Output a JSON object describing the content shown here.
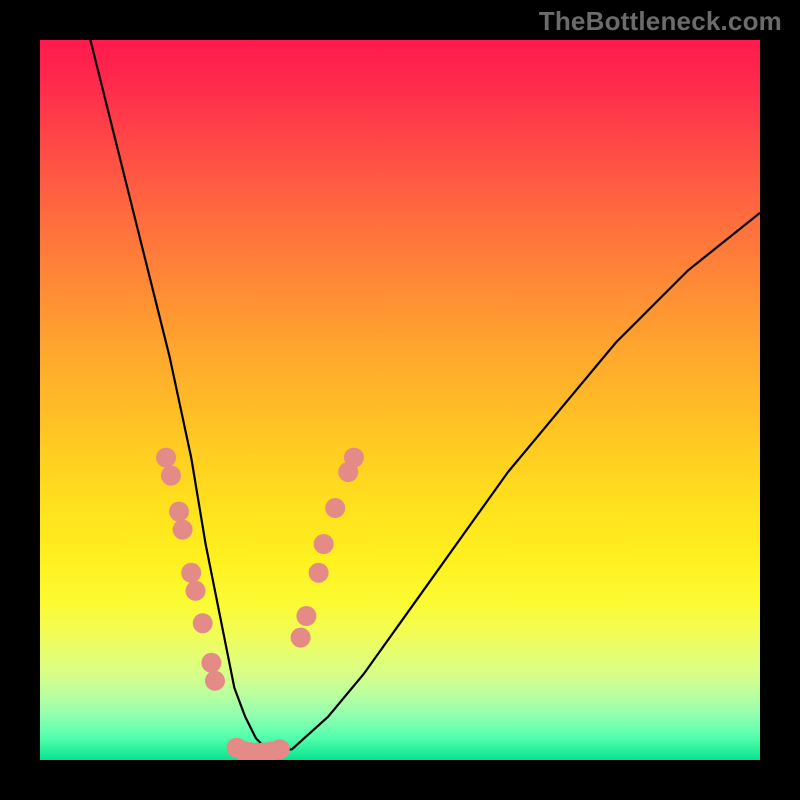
{
  "watermark": "TheBottleneck.com",
  "colors": {
    "frame": "#000000",
    "curve_stroke": "#000000",
    "bead_fill": "#e48b87",
    "gradient_top": "#ff1a4d",
    "gradient_bottom": "#09e28e"
  },
  "chart_data": {
    "type": "line",
    "title": "",
    "xlabel": "",
    "ylabel": "",
    "xlim": [
      0,
      100
    ],
    "ylim": [
      0,
      100
    ],
    "grid": false,
    "legend": false,
    "series": [
      {
        "name": "v-curve",
        "x": [
          7,
          10,
          12,
          14,
          16,
          18,
          19.5,
          21,
          22,
          23,
          24,
          25,
          26,
          27,
          28.5,
          30,
          32,
          35,
          40,
          45,
          50,
          55,
          60,
          65,
          70,
          75,
          80,
          85,
          90,
          95,
          100
        ],
        "y": [
          100,
          88,
          80,
          72,
          64,
          56,
          49,
          42,
          36,
          30,
          25,
          20,
          15,
          10,
          6,
          3,
          1,
          1.5,
          6,
          12,
          19,
          26,
          33,
          40,
          46,
          52,
          58,
          63,
          68,
          72,
          76
        ]
      }
    ],
    "annotations": {
      "beads_left": {
        "x": [
          17.5,
          18.2,
          19.3,
          19.8,
          21.0,
          21.6,
          22.6,
          23.8,
          24.3
        ],
        "y": [
          42,
          39.5,
          34.5,
          32,
          26,
          23.5,
          19,
          13.5,
          11
        ]
      },
      "beads_bottom": {
        "x": [
          27.3,
          28.2,
          29.1,
          30.0,
          31.1,
          32.2,
          33.3
        ],
        "y": [
          1.7,
          1.3,
          1.1,
          1.0,
          1.05,
          1.2,
          1.5
        ]
      },
      "beads_right": {
        "x": [
          36.2,
          37.0,
          38.7,
          39.4,
          41.0,
          42.8,
          43.6
        ],
        "y": [
          17,
          20,
          26,
          30,
          35,
          40,
          42
        ]
      }
    }
  }
}
